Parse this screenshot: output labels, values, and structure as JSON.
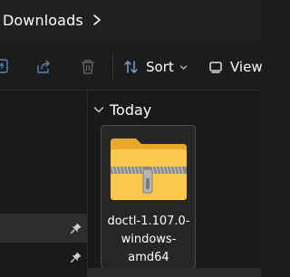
{
  "address_bar": {
    "current_folder": "Downloads"
  },
  "toolbar": {
    "icons": [
      "share-icon",
      "delete-icon"
    ],
    "sort_label": "Sort",
    "view_label": "View"
  },
  "content": {
    "group_header": "Today",
    "file": {
      "name": "doctl-1.107.0-windows-amd64",
      "type_icon": "zip-folder-icon"
    }
  }
}
